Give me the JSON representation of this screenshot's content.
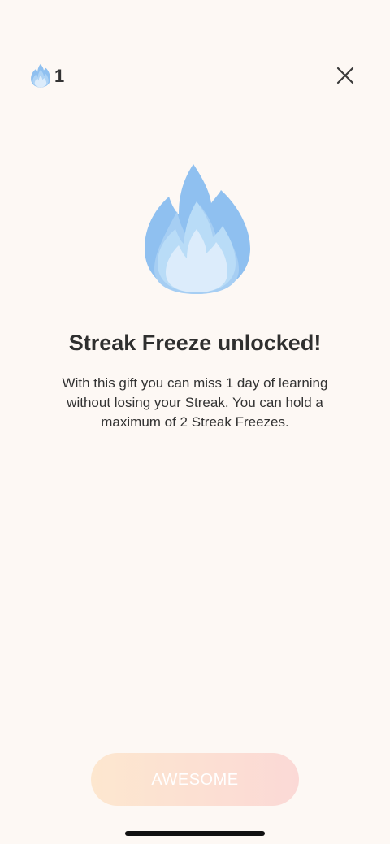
{
  "header": {
    "streak_count": "1",
    "streak_icon": "blue-flame-icon",
    "close_icon": "close-icon"
  },
  "hero": {
    "icon": "blue-flame-icon"
  },
  "content": {
    "title": "Streak Freeze unlocked!",
    "description": "With this gift you can miss 1 day of learning without losing your Streak. You can hold a maximum of 2 Streak Freezes."
  },
  "footer": {
    "awesome_label": "AWESOME"
  },
  "colors": {
    "background": "#fdf8f4",
    "flame_outer": "#8fc0f0",
    "flame_mid": "#aed3f5",
    "flame_inner": "#dcecfb",
    "button_gradient_start": "#fde7cf",
    "button_gradient_end": "#fbd9d6"
  }
}
